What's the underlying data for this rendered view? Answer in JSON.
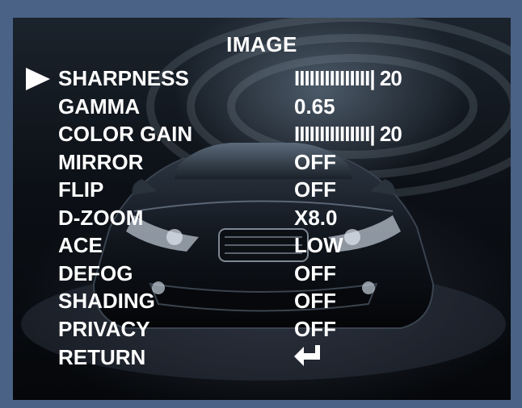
{
  "menu": {
    "title": "IMAGE",
    "items": [
      {
        "label": "SHARPNESS",
        "value": "IIIIIIIIIIIIIII| 20",
        "selected": true
      },
      {
        "label": "GAMMA",
        "value": "0.65"
      },
      {
        "label": "COLOR GAIN",
        "value": "IIIIIIIIIIIIIII| 20"
      },
      {
        "label": "MIRROR",
        "value": "OFF"
      },
      {
        "label": "FLIP",
        "value": "OFF"
      },
      {
        "label": "D-ZOOM",
        "value": "X8.0"
      },
      {
        "label": "ACE",
        "value": "LOW"
      },
      {
        "label": "DEFOG",
        "value": "OFF"
      },
      {
        "label": "SHADING",
        "value": "OFF"
      },
      {
        "label": "PRIVACY",
        "value": "OFF"
      },
      {
        "label": "RETURN",
        "value": ""
      }
    ],
    "return_icon": "enter-arrow-icon",
    "cursor_icon": "triangle-right-icon"
  },
  "colors": {
    "frame": "#4a6285",
    "text": "#ffffff"
  }
}
